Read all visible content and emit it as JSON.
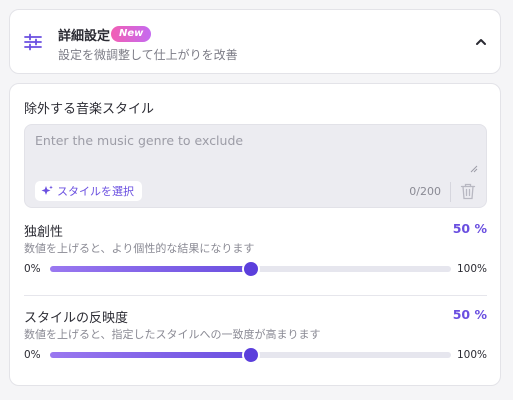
{
  "header": {
    "title": "詳細設定",
    "badge": "New",
    "subtitle": "設定を微調整して仕上がりを改善",
    "icons": {
      "settings": "sliders-icon",
      "toggle": "chevron-up-icon"
    }
  },
  "exclude": {
    "label": "除外する音楽スタイル",
    "placeholder": "Enter the music genre to exclude",
    "value": "",
    "select_button": "スタイルを選択",
    "counter": "0/200",
    "icons": {
      "select": "sparkle-icon",
      "clear": "trash-icon"
    }
  },
  "sliders": [
    {
      "title": "独創性",
      "value_text": "50 %",
      "description": "数値を上げると、より個性的な結果になります",
      "min_label": "0%",
      "max_label": "100%",
      "value": 50
    },
    {
      "title": "スタイルの反映度",
      "value_text": "50 %",
      "description": "数値を上げると、指定したスタイルへの一致度が高まります",
      "min_label": "0%",
      "max_label": "100%",
      "value": 50
    }
  ],
  "colors": {
    "accent": "#6a4fe0",
    "badge_start": "#f25fb4",
    "badge_end": "#c56af0"
  }
}
